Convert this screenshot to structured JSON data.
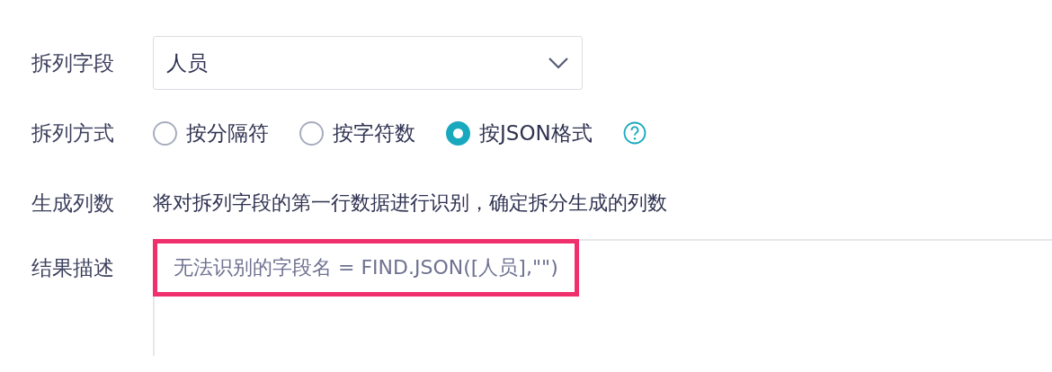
{
  "split_field": {
    "label": "拆列字段",
    "value": "人员"
  },
  "split_method": {
    "label": "拆列方式",
    "options": [
      {
        "label": "按分隔符",
        "selected": false
      },
      {
        "label": "按字符数",
        "selected": false
      },
      {
        "label": "按JSON格式",
        "selected": true
      }
    ]
  },
  "generated_columns": {
    "label": "生成列数",
    "text": "将对拆列字段的第一行数据进行识别，确定拆分生成的列数"
  },
  "result_description": {
    "label": "结果描述",
    "value": "无法识别的字段名 = FIND.JSON([人员],\"\")",
    "highlighted": true
  }
}
